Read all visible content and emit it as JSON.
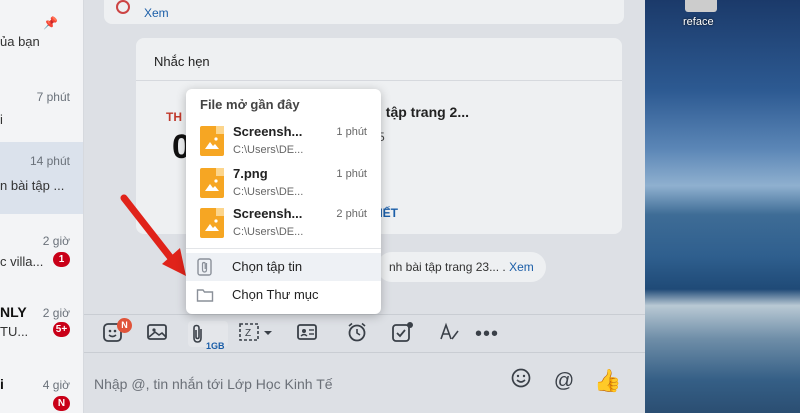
{
  "desktop": {
    "icon_label": "reface"
  },
  "sidebar": {
    "items": [
      {
        "preview": "ủa bạn",
        "pinned": true
      },
      {
        "time": "7 phút",
        "preview": "i"
      },
      {
        "time": "14 phút",
        "preview": "n bài tập ...",
        "active": true
      },
      {
        "time": "2 giờ",
        "preview": "c villa...",
        "badge": "1"
      },
      {
        "name": "NLY",
        "time": "2 giờ",
        "preview": "TU...",
        "badge": "5+"
      },
      {
        "name": "i",
        "time": "4 giờ",
        "preview": "",
        "badge": "N"
      }
    ]
  },
  "chat": {
    "top_card_link": "Xem",
    "reminder": {
      "title": "Nhắc hẹn",
      "month": "TH",
      "day": "0",
      "heading": "i tập trang 2...",
      "count": "5",
      "action": "TIẾT"
    },
    "notice": {
      "text": "nh bài tập trang 23... .",
      "link": "Xem"
    }
  },
  "toolbar": {
    "sticker_badge": "N",
    "attach_size": "1GB"
  },
  "composer": {
    "placeholder": "Nhập @, tin nhắn tới Lớp Học Kinh Tế"
  },
  "popup": {
    "title": "File mở gần đây",
    "files": [
      {
        "name": "Screensh...",
        "path": "C:\\Users\\DE...",
        "time": "1 phút"
      },
      {
        "name": "7.png",
        "path": "C:\\Users\\DE...",
        "time": "1 phút"
      },
      {
        "name": "Screensh...",
        "path": "C:\\Users\\DE...",
        "time": "2 phút"
      }
    ],
    "choose_file": "Chọn tập tin",
    "choose_folder": "Chọn Thư mục"
  },
  "colors": {
    "accent": "#1b5ea8",
    "badge": "#c90018",
    "file_icon": "#f6a623",
    "arrow": "#e0231a"
  }
}
